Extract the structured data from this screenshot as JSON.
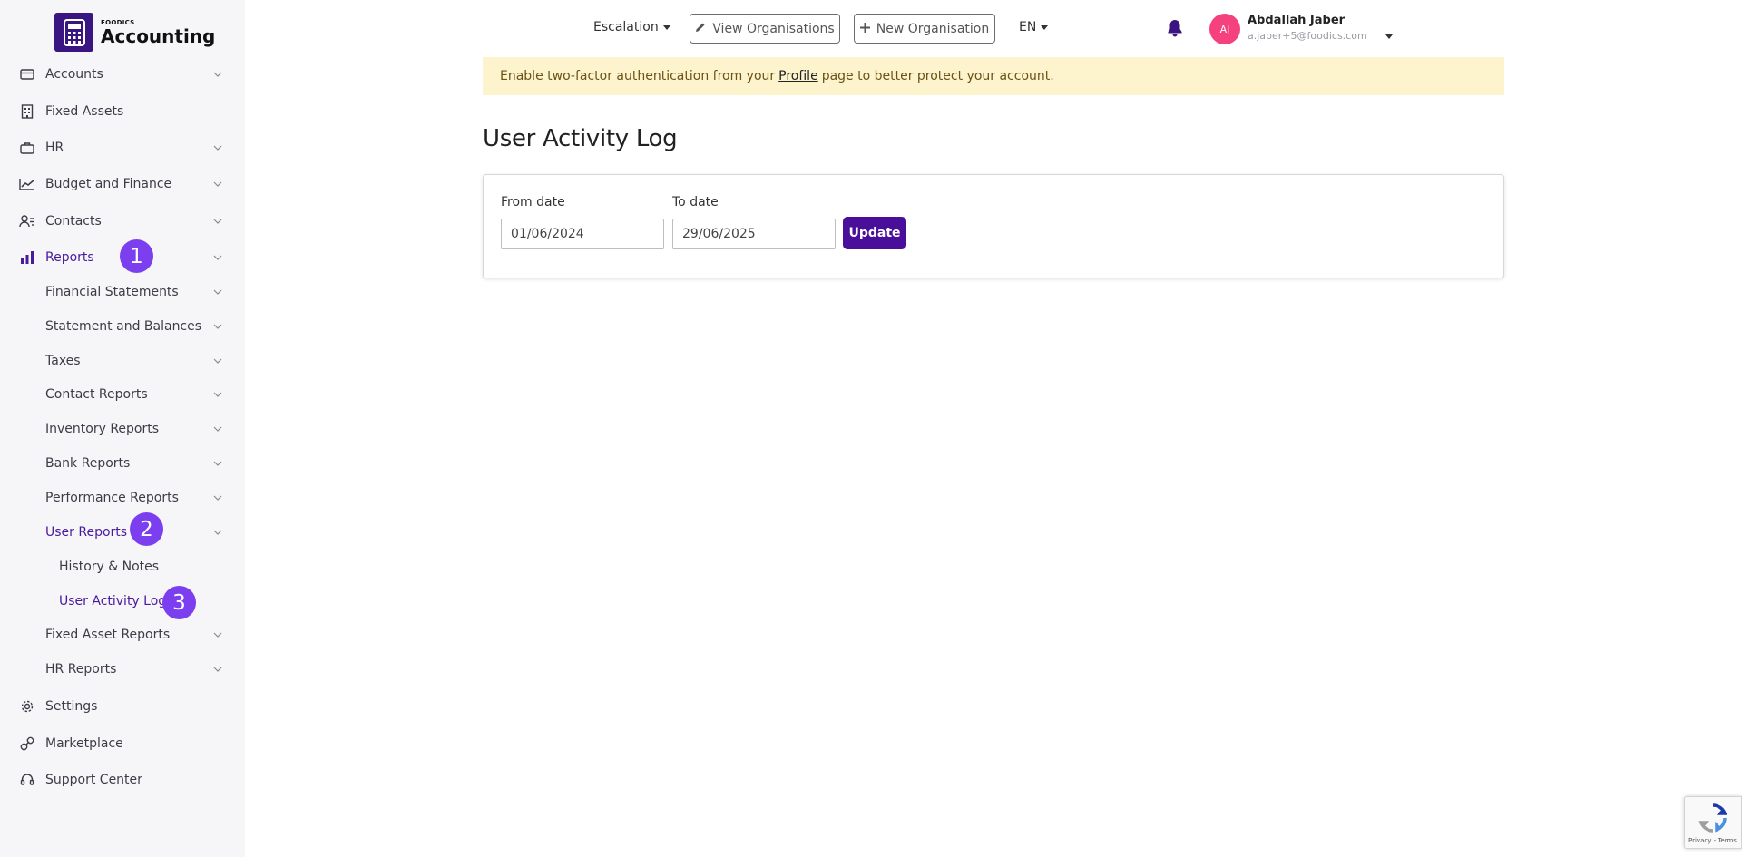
{
  "logo": {
    "brand": "FOODICS",
    "product": "Accounting"
  },
  "sidebar": {
    "items": [
      {
        "label": "Accounts",
        "icon": "wallet-icon"
      },
      {
        "label": "Fixed Assets",
        "icon": "building-icon"
      },
      {
        "label": "HR",
        "icon": "briefcase-icon"
      },
      {
        "label": "Budget and Finance",
        "icon": "line-chart-icon"
      },
      {
        "label": "Contacts",
        "icon": "contacts-icon"
      },
      {
        "label": "Reports",
        "icon": "bar-chart-icon"
      },
      {
        "label": "Settings",
        "icon": "gear-icon"
      },
      {
        "label": "Marketplace",
        "icon": "link-icon"
      },
      {
        "label": "Support Center",
        "icon": "headset-icon"
      }
    ],
    "reports_sub": [
      "Financial Statements",
      "Statement and Balances",
      "Taxes",
      "Contact Reports",
      "Inventory Reports",
      "Bank Reports",
      "Performance Reports",
      "User Reports",
      "Fixed Asset Reports",
      "HR Reports"
    ],
    "user_reports_sub": [
      "History & Notes",
      "User Activity Log"
    ],
    "badges": [
      "1",
      "2",
      "3"
    ]
  },
  "topbar": {
    "escalation": "Escalation",
    "view_orgs": "View Organisations",
    "new_org": "New Organisation",
    "language": "EN",
    "user_initials": "AJ",
    "user_name": "Abdallah Jaber",
    "user_email": "a.jaber+5@foodics.com"
  },
  "alert": {
    "before": "Enable two-factor authentication from your",
    "link": "Profile",
    "after": "page to better protect your account."
  },
  "page": {
    "title": "User Activity Log",
    "from_label": "From date",
    "from_value": "01/06/2024",
    "to_label": "To date",
    "to_value": "29/06/2025",
    "update": "Update"
  },
  "recaptcha": "Privacy - Terms",
  "colors": {
    "accent": "#4a0f9a",
    "badge": "#7b3ff0",
    "alert_bg": "#fdf3cc",
    "avatar": "#f5427e"
  }
}
